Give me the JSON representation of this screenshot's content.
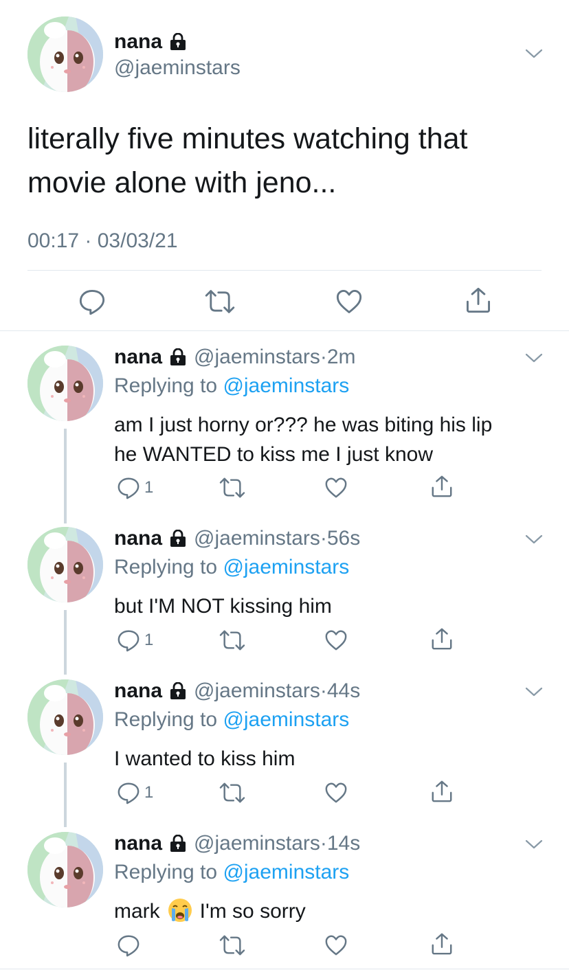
{
  "main_tweet": {
    "name": "nana",
    "handle": "@jaeminstars",
    "text_line1": "literally five minutes watching that",
    "text_line2": "movie alone with jeno...",
    "timestamp": "00:17 · 03/03/21"
  },
  "replies": [
    {
      "name": "nana",
      "handle": "@jaeminstars",
      "dot": "·",
      "age": "2m",
      "replying_prefix": "Replying to ",
      "replying_to": "@jaeminstars",
      "line1": "am I just horny or??? he was biting his lip",
      "line2": "he WANTED to kiss me I just know",
      "reply_count": "1"
    },
    {
      "name": "nana",
      "handle": "@jaeminstars",
      "dot": "·",
      "age": "56s",
      "replying_prefix": "Replying to ",
      "replying_to": "@jaeminstars",
      "line1": "but I'M NOT kissing him",
      "reply_count": "1"
    },
    {
      "name": "nana",
      "handle": "@jaeminstars",
      "dot": "·",
      "age": "44s",
      "replying_prefix": "Replying to ",
      "replying_to": "@jaeminstars",
      "line1": "I wanted to kiss him",
      "reply_count": "1"
    },
    {
      "name": "nana",
      "handle": "@jaeminstars",
      "dot": "·",
      "age": "14s",
      "replying_prefix": "Replying to ",
      "replying_to": "@jaeminstars",
      "line1_before_emoji": "mark",
      "emoji": "loudly-crying-face",
      "line1_after_emoji": "I'm so sorry"
    }
  ],
  "icons": {
    "reply": "reply-icon",
    "retweet": "retweet-icon",
    "like": "heart-icon",
    "share": "share-icon",
    "lock": "lock-icon",
    "menu": "chevron-down-icon"
  },
  "colors": {
    "text": "#14171a",
    "secondary": "#657786",
    "link": "#1da1f2",
    "divider": "#e1e8ed",
    "thread_line": "#ccd6dd"
  }
}
